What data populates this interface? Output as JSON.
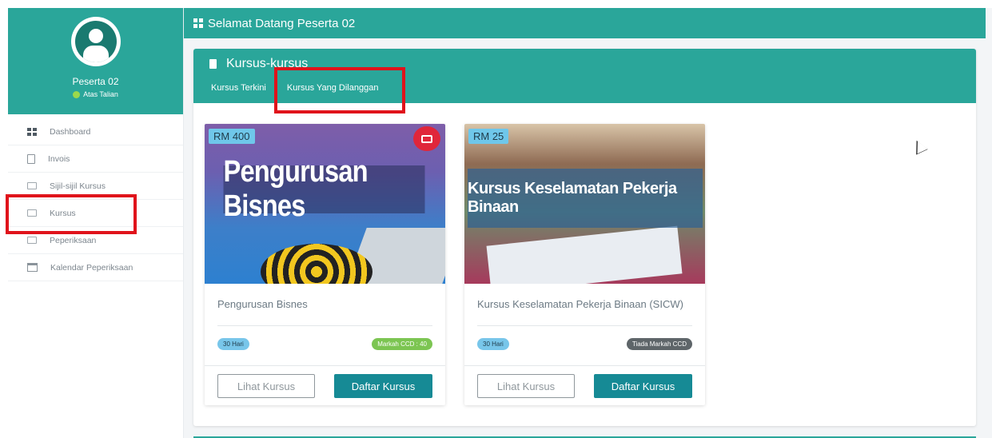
{
  "profile": {
    "name": "Peserta 02",
    "status": "Atas Talian"
  },
  "sidebar": {
    "items": [
      {
        "label": "Dashboard",
        "icon": "grid-icon"
      },
      {
        "label": "Invois",
        "icon": "document-icon"
      },
      {
        "label": "Sijil-sijil Kursus",
        "icon": "certificate-icon"
      },
      {
        "label": "Kursus",
        "icon": "course-icon"
      },
      {
        "label": "Peperiksaan",
        "icon": "exam-icon"
      },
      {
        "label": "Kalendar Peperiksaan",
        "icon": "calendar-icon"
      }
    ]
  },
  "header": {
    "title": "Selamat Datang Peserta 02"
  },
  "panel": {
    "title": "Kursus-kursus",
    "tabs": [
      {
        "label": "Kursus Terkini"
      },
      {
        "label": "Kursus Yang Dilanggan"
      }
    ]
  },
  "courses": [
    {
      "price": "RM 400",
      "banner": "Pengurusan Bisnes",
      "title": "Pengurusan Bisnes",
      "duration": "30 Hari",
      "ccd": "Markah CCD : 40",
      "view_label": "Lihat Kursus",
      "enroll_label": "Daftar Kursus"
    },
    {
      "price": "RM 25",
      "banner": "Kursus Keselamatan Pekerja Binaan",
      "title": "Kursus Keselamatan Pekerja Binaan (SICW)",
      "duration": "30 Hari",
      "ccd": "Tiada Markah CCD",
      "view_label": "Lihat Kursus",
      "enroll_label": "Daftar Kursus"
    }
  ],
  "colors": {
    "primary": "#2aa69a",
    "button": "#168a95",
    "highlight": "#e0131b",
    "online": "#9bd84c"
  }
}
